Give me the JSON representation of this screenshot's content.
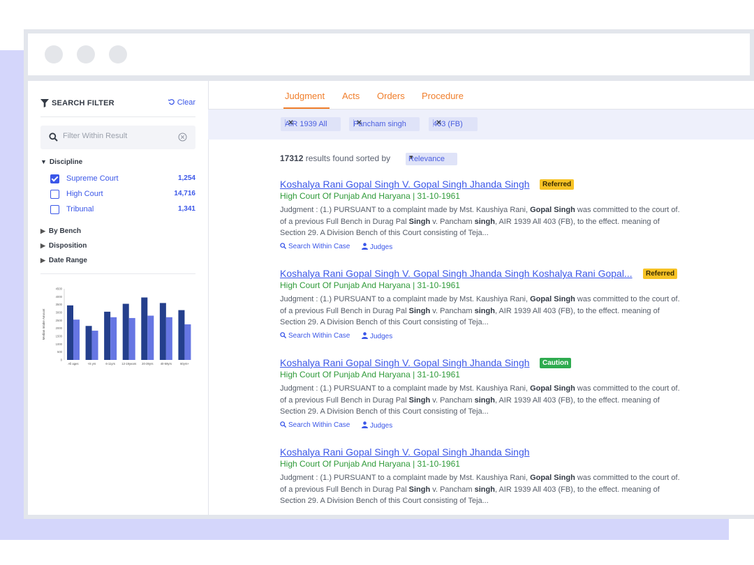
{
  "sidebar": {
    "title": "SEARCH FILTER",
    "clear_label": "Clear",
    "filter_placeholder": "Filter Within Result",
    "discipline": {
      "label": "Discipline",
      "items": [
        {
          "label": "Supreme Court",
          "count": "1,254",
          "checked": true
        },
        {
          "label": "High Court",
          "count": "14,716",
          "checked": false
        },
        {
          "label": "Tribunal",
          "count": "1,341",
          "checked": false
        }
      ]
    },
    "collapsed": [
      "By Bench",
      "Disposition",
      "Date Range"
    ]
  },
  "chart_data": {
    "type": "bar",
    "ylabel": "Median Intake Amount",
    "ylim": [
      0,
      4500
    ],
    "yticks": [
      0,
      500,
      1000,
      1500,
      2000,
      2500,
      3000,
      3500,
      4000,
      4500
    ],
    "categories": [
      "All ages",
      "<6 yrs",
      "6-11yrs",
      "12-19years",
      "20-39yrs",
      "40-59yrs",
      "60yrs+"
    ],
    "series": [
      {
        "values": [
          3450,
          2150,
          3050,
          3550,
          3950,
          3600,
          3150
        ],
        "color": "#243f8c"
      },
      {
        "values": [
          2550,
          1850,
          2700,
          2650,
          2800,
          2700,
          2250
        ],
        "color": "#6676e3"
      }
    ],
    "grid": false
  },
  "tabs": [
    "Judgment",
    "Acts",
    "Orders",
    "Procedure"
  ],
  "active_tab": "Judgment",
  "chips": [
    "AIR 1939 All",
    "Pancham singh",
    "403 (FB)"
  ],
  "results_count": "17312",
  "results_text": "results found sorted by",
  "sort_value": "Relevance",
  "actions": {
    "search_within": "Search Within Case",
    "judges": "Judges"
  },
  "results": [
    {
      "title": "Koshalya Rani Gopal Singh V. Gopal Singh Jhanda Singh",
      "badge": "Referred",
      "court": "High Court Of Punjab And Haryana | 31-10-1961",
      "snippet": [
        {
          "t": "Judgment : (1.) PURSUANT to a complaint made by Mst. Kaushiya Rani, "
        },
        {
          "t": "Gopal Singh",
          "b": true
        },
        {
          "t": " was committed to the court of. of a previous Full Bench in Durag Pal "
        },
        {
          "t": "Singh",
          "b": true
        },
        {
          "t": " v. Pancham "
        },
        {
          "t": "singh",
          "b": true
        },
        {
          "t": ", AIR 1939 All 403 (FB), to the effect. meaning of Section 29. A Division Bench of this Court consisting of Teja..."
        }
      ]
    },
    {
      "title": "Koshalya Rani Gopal Singh V. Gopal Singh Jhanda Singh Koshalya Rani Gopal...",
      "badge": "Referred",
      "court": "High Court Of Punjab And Haryana | 31-10-1961",
      "snippet": [
        {
          "t": "Judgment : (1.) PURSUANT to a complaint made by Mst. Kaushiya Rani, "
        },
        {
          "t": "Gopal Singh",
          "b": true
        },
        {
          "t": " was committed to the court of. of a previous Full Bench in Durag Pal "
        },
        {
          "t": "Singh",
          "b": true
        },
        {
          "t": " v. Pancham "
        },
        {
          "t": "singh",
          "b": true
        },
        {
          "t": ", AIR 1939 All 403 (FB), to the effect. meaning of Section 29. A Division Bench of this Court consisting of Teja..."
        }
      ]
    },
    {
      "title": "Koshalya Rani Gopal Singh V. Gopal Singh Jhanda Singh",
      "badge": "Caution",
      "court": "High Court Of Punjab And Haryana | 31-10-1961",
      "snippet": [
        {
          "t": "Judgment : (1.) PURSUANT to a complaint made by Mst. Kaushiya Rani, "
        },
        {
          "t": "Gopal Singh",
          "b": true
        },
        {
          "t": " was committed to the court of. of a previous Full Bench in Durag Pal "
        },
        {
          "t": "Singh",
          "b": true
        },
        {
          "t": " v. Pancham "
        },
        {
          "t": "singh",
          "b": true
        },
        {
          "t": ", AIR 1939 All 403 (FB), to the effect. meaning of Section 29. A Division Bench of this Court consisting of Teja..."
        }
      ]
    },
    {
      "title": "Koshalya Rani Gopal Singh V. Gopal Singh Jhanda Singh",
      "badge": "",
      "court": "High Court Of Punjab And Haryana | 31-10-1961",
      "snippet": [
        {
          "t": "Judgment : (1.) PURSUANT to a complaint made by Mst. Kaushiya Rani, "
        },
        {
          "t": "Gopal Singh",
          "b": true
        },
        {
          "t": " was committed to the court of. of a previous Full Bench in Durag Pal "
        },
        {
          "t": "Singh",
          "b": true
        },
        {
          "t": " v. Pancham "
        },
        {
          "t": "singh",
          "b": true
        },
        {
          "t": ", AIR 1939 All 403 (FB), to the effect. meaning of Section 29. A Division Bench of this Court consisting of Teja..."
        }
      ]
    }
  ]
}
